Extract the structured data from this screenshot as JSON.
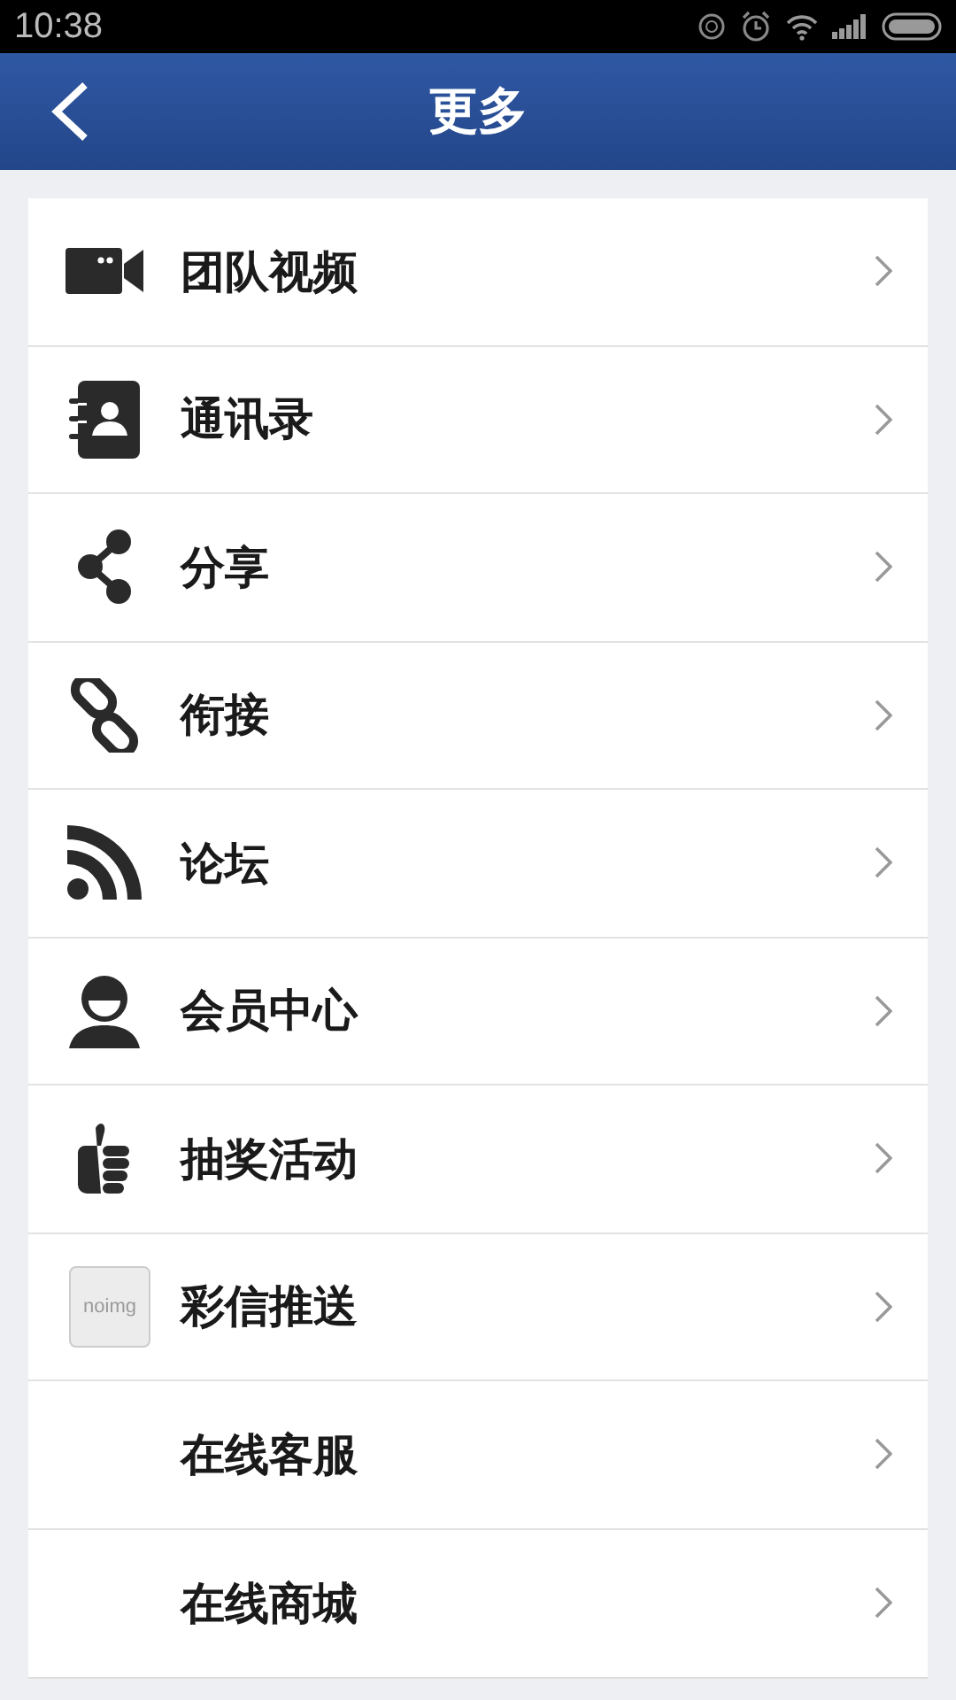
{
  "status_bar": {
    "time": "10:38"
  },
  "header": {
    "title": "更多"
  },
  "items": [
    {
      "label": "团队视频",
      "kind": "video"
    },
    {
      "label": "通讯录",
      "kind": "contacts"
    },
    {
      "label": "分享",
      "kind": "share"
    },
    {
      "label": "衔接",
      "kind": "link"
    },
    {
      "label": "论坛",
      "kind": "rss"
    },
    {
      "label": "会员中心",
      "kind": "user"
    },
    {
      "label": "抽奖活动",
      "kind": "thumb"
    },
    {
      "label": "彩信推送",
      "kind": "noimg",
      "icon_text": "noimg"
    },
    {
      "label": "在线客服",
      "kind": "plain"
    },
    {
      "label": "在线商城",
      "kind": "plain"
    }
  ]
}
